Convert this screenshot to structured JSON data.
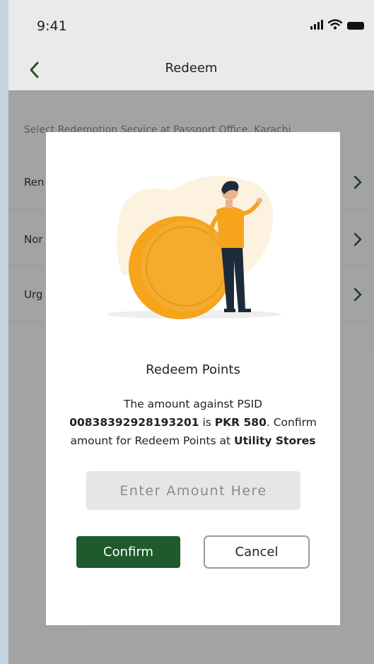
{
  "status_bar": {
    "time": "9:41",
    "icons": [
      "signal-icon",
      "wifi-icon",
      "battery-icon"
    ]
  },
  "nav": {
    "title": "Redeem",
    "back_icon": "chevron-left-icon"
  },
  "page": {
    "section_label": "Select Redemption Service at Passport Office, Karachi",
    "services": [
      {
        "label": "Ren"
      },
      {
        "label": "Nor"
      },
      {
        "label": "Urg"
      }
    ]
  },
  "modal": {
    "title": "Redeem Points",
    "text_prefix": "The amount against PSID",
    "psid": "00838392928193201",
    "text_is": "is",
    "amount": "PKR 580",
    "text_confirm": ". Confirm amount for Redeem Points at",
    "store": "Utility Stores",
    "input_placeholder": "Enter Amount Here",
    "input_value": "",
    "confirm_label": "Confirm",
    "cancel_label": "Cancel"
  },
  "colors": {
    "accent_green": "#1f5a2c",
    "coin_orange": "#f5a41c",
    "backdrop": "#c5d3df"
  }
}
